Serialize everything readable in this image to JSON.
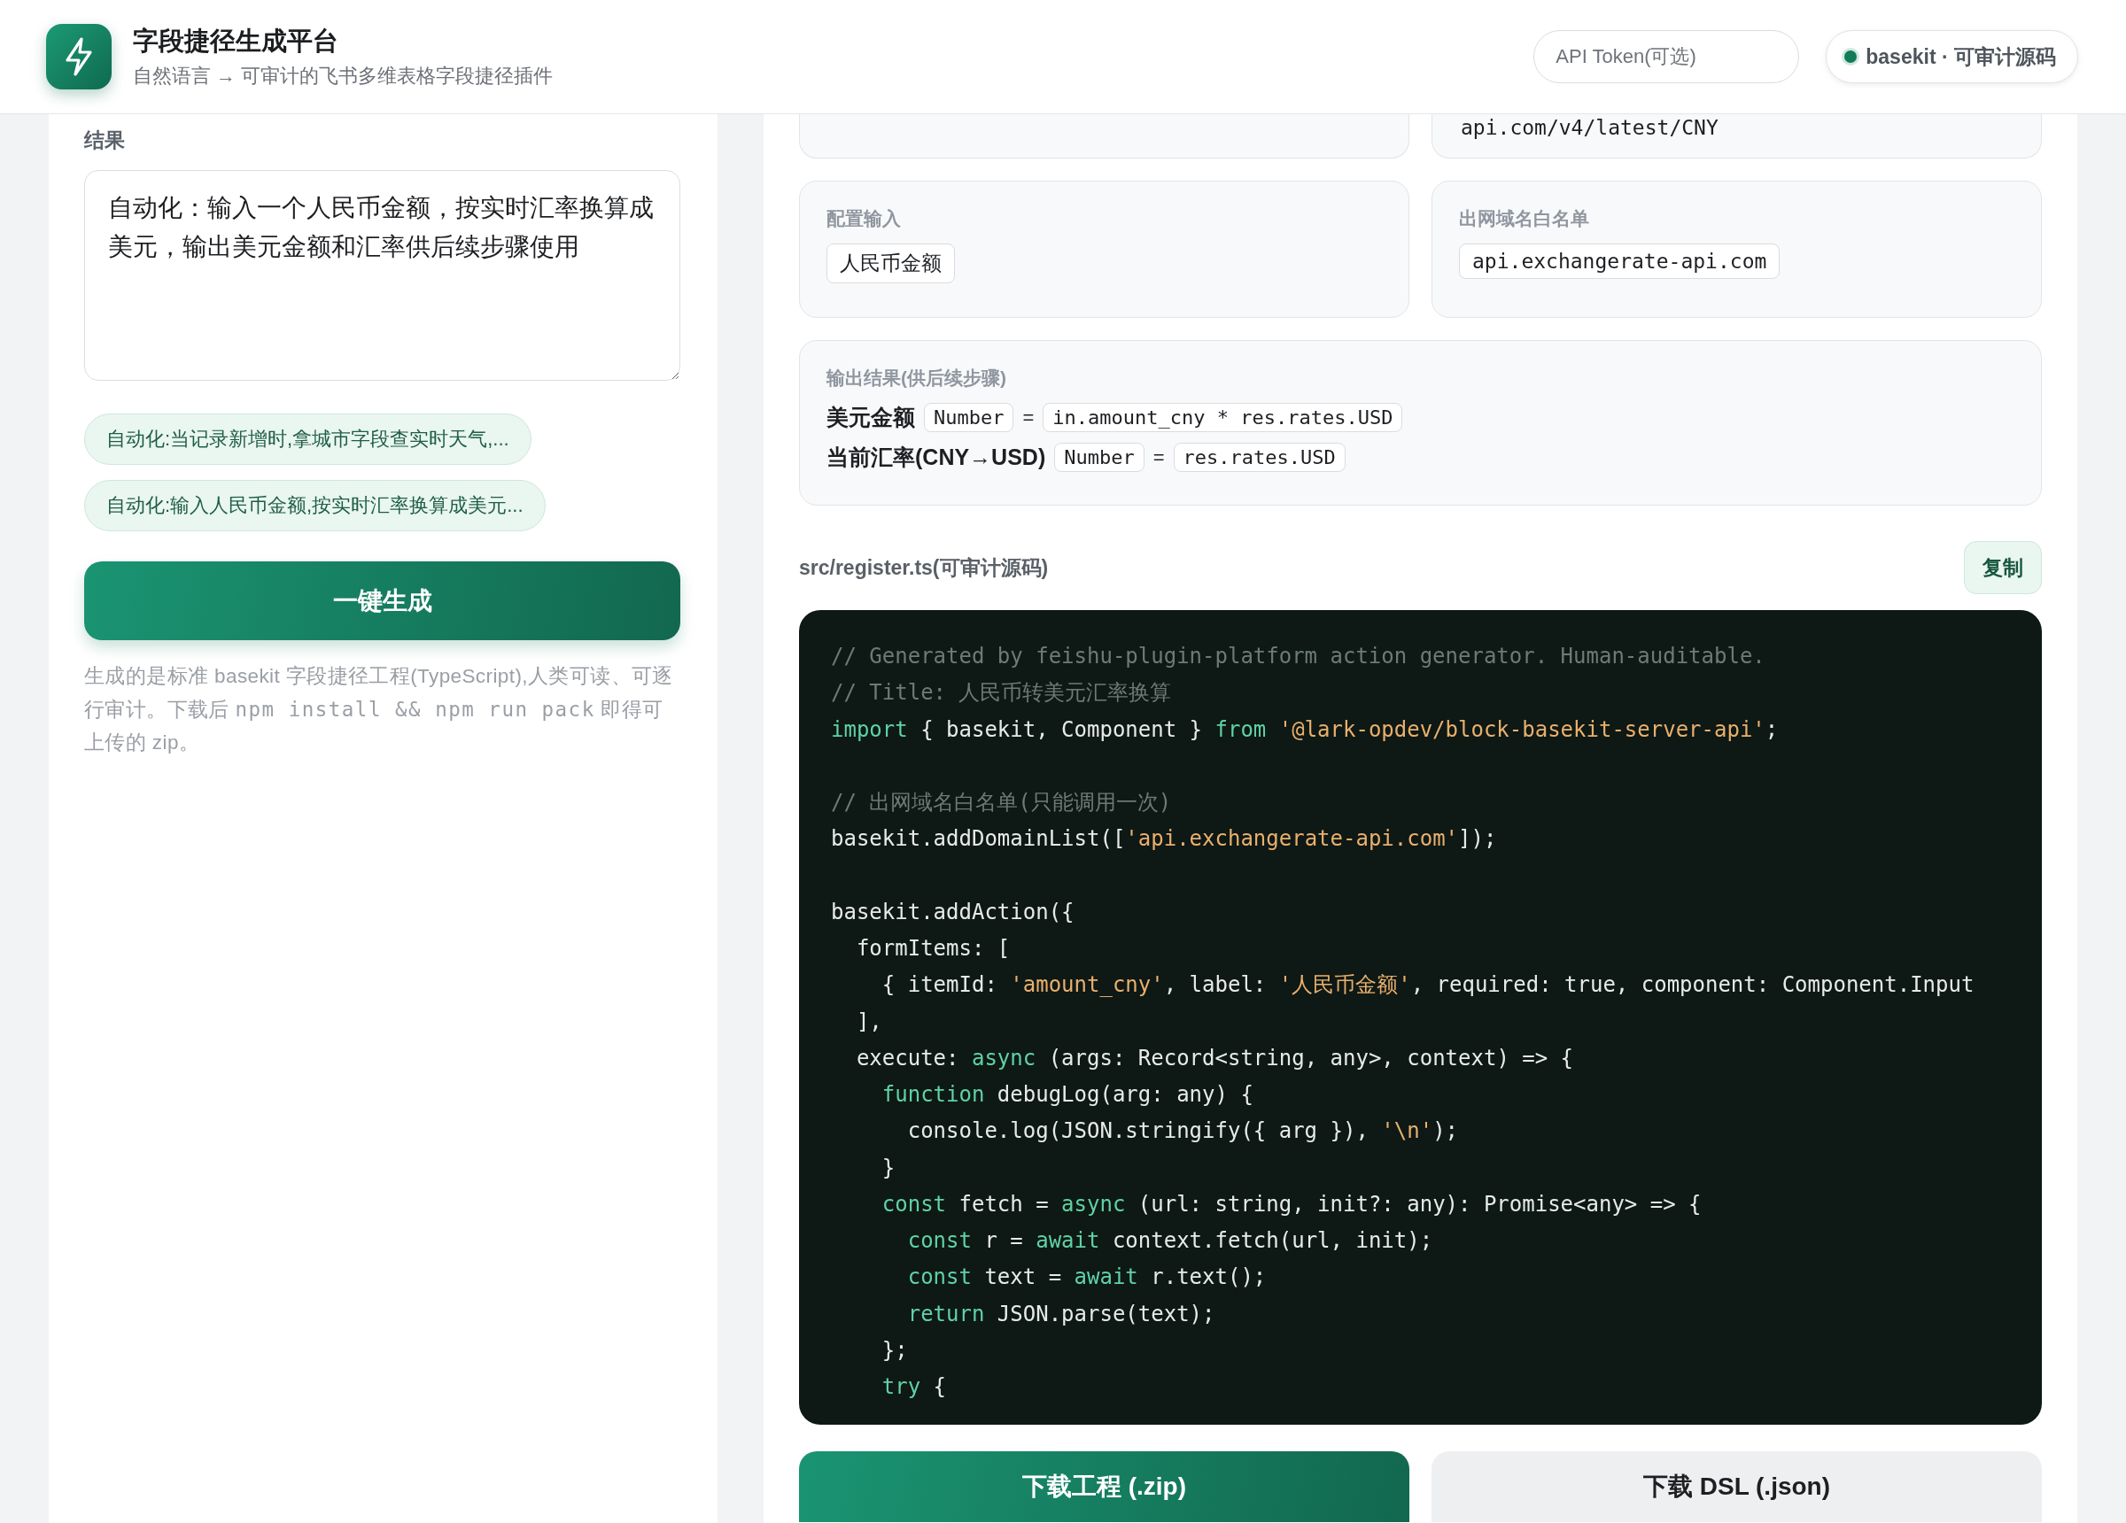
{
  "header": {
    "title": "字段捷径生成平台",
    "subtitle": "自然语言 → 可审计的飞书多维表格字段捷径插件",
    "token_field": {
      "placeholder": "API Token(可选)"
    },
    "badge": {
      "label": "basekit · 可审计源码"
    }
  },
  "left_panel": {
    "label": "结果",
    "description": "自动化：输入一个人民币金额，按实时汇率换算成美元，输出美元金额和汇率供后续步骤使用",
    "examples": [
      "自动化:当记录新增时,拿城市字段查实时天气,...",
      "自动化:输入人民币金额,按实时汇率换算成美元..."
    ],
    "generate_button": "一键生成",
    "hint": [
      {
        "kind": "text",
        "text": "生成的是标准 basekit 字段捷径工程(TypeScript),人类可读、可逐行审计。下载后 "
      },
      {
        "kind": "code",
        "text": "npm install && npm run pack"
      },
      {
        "kind": "text",
        "text": " 即得可上传的 zip。"
      }
    ]
  },
  "right_panel": {
    "top_cards": [
      {
        "kind": "blank"
      },
      {
        "kind": "text",
        "value": "api.com/v4/latest/CNY"
      }
    ],
    "config_cards": [
      {
        "label": "配置输入",
        "chip": "人民币金额",
        "kind": "text"
      },
      {
        "label": "出网域名白名单",
        "chip": "api.exchangerate-api.com",
        "kind": "code"
      }
    ],
    "outputs": {
      "label": "输出结果(供后续步骤)",
      "rows": [
        {
          "name": "美元金额",
          "type": "Number",
          "equals": "=",
          "expression": "in.amount_cny * res.rates.USD"
        },
        {
          "name": "当前汇率(CNY→USD)",
          "type": "Number",
          "equals": "=",
          "expression": "res.rates.USD"
        }
      ]
    },
    "source": {
      "filename": "src/register.ts(可审计源码)",
      "copy_button": "复制",
      "lines": [
        {
          "kind": "code",
          "tokens": [
            {
              "kind": "comment",
              "text": "// Generated by feishu-plugin-platform action generator. Human-auditable."
            }
          ]
        },
        {
          "kind": "code",
          "tokens": [
            {
              "kind": "comment",
              "text": "// Title: 人民币转美元汇率换算"
            }
          ]
        },
        {
          "kind": "code",
          "tokens": [
            {
              "kind": "kw",
              "text": "import"
            },
            {
              "kind": "plain",
              "text": " { basekit, Component } "
            },
            {
              "kind": "kw",
              "text": "from"
            },
            {
              "kind": "str",
              "text": " '@lark-opdev/block-basekit-server-api'"
            },
            {
              "kind": "plain",
              "text": ";"
            }
          ]
        },
        {
          "kind": "blank"
        },
        {
          "kind": "code",
          "tokens": [
            {
              "kind": "comment",
              "text": "// 出网域名白名单(只能调用一次)"
            }
          ]
        },
        {
          "kind": "code",
          "tokens": [
            {
              "kind": "plain",
              "text": "basekit.addDomainList(["
            },
            {
              "kind": "str",
              "text": "'api.exchangerate-api.com'"
            },
            {
              "kind": "plain",
              "text": "]);"
            }
          ]
        },
        {
          "kind": "blank"
        },
        {
          "kind": "code",
          "tokens": [
            {
              "kind": "plain",
              "text": "basekit.addAction({"
            }
          ]
        },
        {
          "kind": "code",
          "tokens": [
            {
              "kind": "plain",
              "text": "  formItems: ["
            }
          ]
        },
        {
          "kind": "code",
          "tokens": [
            {
              "kind": "plain",
              "text": "    { itemId: "
            },
            {
              "kind": "str",
              "text": "'amount_cny'"
            },
            {
              "kind": "plain",
              "text": ", label: "
            },
            {
              "kind": "str",
              "text": "'人民币金额'"
            },
            {
              "kind": "plain",
              "text": ", required: true, component: Component.Input"
            }
          ]
        },
        {
          "kind": "code",
          "tokens": [
            {
              "kind": "plain",
              "text": "  ],"
            }
          ]
        },
        {
          "kind": "code",
          "tokens": [
            {
              "kind": "plain",
              "text": "  execute: "
            },
            {
              "kind": "kw",
              "text": "async"
            },
            {
              "kind": "plain",
              "text": " (args: Record<string, any>, context) => {"
            }
          ]
        },
        {
          "kind": "code",
          "tokens": [
            {
              "kind": "kw",
              "text": "    function"
            },
            {
              "kind": "plain",
              "text": " debugLog(arg: any) {"
            }
          ]
        },
        {
          "kind": "code",
          "tokens": [
            {
              "kind": "plain",
              "text": "      console.log(JSON.stringify({ arg }), "
            },
            {
              "kind": "str",
              "text": "'\\n'"
            },
            {
              "kind": "plain",
              "text": ");"
            }
          ]
        },
        {
          "kind": "code",
          "tokens": [
            {
              "kind": "plain",
              "text": "    }"
            }
          ]
        },
        {
          "kind": "code",
          "tokens": [
            {
              "kind": "kw",
              "text": "    const"
            },
            {
              "kind": "plain",
              "text": " fetch = "
            },
            {
              "kind": "kw",
              "text": "async"
            },
            {
              "kind": "plain",
              "text": " (url: string, init?: any): Promise<any> => {"
            }
          ]
        },
        {
          "kind": "code",
          "tokens": [
            {
              "kind": "kw",
              "text": "      const"
            },
            {
              "kind": "plain",
              "text": " r = "
            },
            {
              "kind": "kw",
              "text": "await"
            },
            {
              "kind": "plain",
              "text": " context.fetch(url, init);"
            }
          ]
        },
        {
          "kind": "code",
          "tokens": [
            {
              "kind": "kw",
              "text": "      const"
            },
            {
              "kind": "plain",
              "text": " text = "
            },
            {
              "kind": "kw",
              "text": "await"
            },
            {
              "kind": "plain",
              "text": " r.text();"
            }
          ]
        },
        {
          "kind": "code",
          "tokens": [
            {
              "kind": "kw",
              "text": "      return"
            },
            {
              "kind": "plain",
              "text": " JSON.parse(text);"
            }
          ]
        },
        {
          "kind": "code",
          "tokens": [
            {
              "kind": "plain",
              "text": "    };"
            }
          ]
        },
        {
          "kind": "code",
          "tokens": [
            {
              "kind": "kw",
              "text": "    try"
            },
            {
              "kind": "plain",
              "text": " {"
            }
          ]
        }
      ]
    },
    "downloads": [
      {
        "label": "下载工程 (.zip)",
        "kind": "primary"
      },
      {
        "label": "下载 DSL (.json)",
        "kind": "secondary"
      }
    ]
  }
}
